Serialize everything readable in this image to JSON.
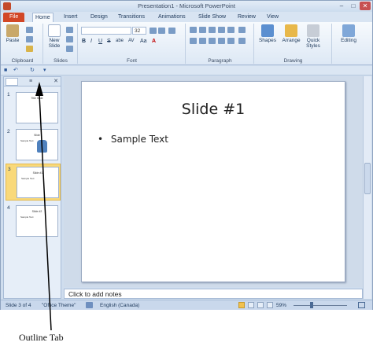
{
  "window": {
    "title": "Presentation1 - Microsoft PowerPoint",
    "min_icon": "–",
    "max_icon": "□",
    "close_icon": "✕"
  },
  "tabs": [
    "File",
    "Home",
    "Insert",
    "Design",
    "Transitions",
    "Animations",
    "Slide Show",
    "Review",
    "View"
  ],
  "ribbon": {
    "clipboard": {
      "paste_label": "Paste",
      "group_label": "Clipboard"
    },
    "slides": {
      "new_slide_label": "New Slide",
      "group_label": "Slides"
    },
    "font": {
      "font_size": "32",
      "bold": "B",
      "italic": "I",
      "underline": "U",
      "strike": "S",
      "shadow": "abe",
      "spacing": "AV",
      "case": "Aa",
      "color": "A",
      "group_label": "Font"
    },
    "paragraph": {
      "group_label": "Paragraph"
    },
    "drawing": {
      "shapes_label": "Shapes",
      "arrange_label": "Arrange",
      "quick_styles_label": "Quick Styles",
      "group_label": "Drawing"
    },
    "editing": {
      "editing_label": "Editing"
    }
  },
  "qat": {
    "save": "■",
    "undo": "↶",
    "redo": "↻",
    "more": "▾"
  },
  "pane": {
    "outline_tab_icon": "≡",
    "close_icon": "✕",
    "slides": [
      {
        "num": "1",
        "title": "Title Slide",
        "body": ""
      },
      {
        "num": "2",
        "title": "Slide",
        "body": "Sample Text"
      },
      {
        "num": "3",
        "title": "Slide #1",
        "body": "Sample Text"
      },
      {
        "num": "4",
        "title": "Slide #2",
        "body": "Sample Text"
      }
    ]
  },
  "slide": {
    "title": "Slide #1",
    "bullet": "•",
    "body": "Sample Text"
  },
  "notes": {
    "placeholder": "Click to add notes"
  },
  "status": {
    "slide_count": "Slide 3 of 4",
    "theme": "\"Office Theme\"",
    "language": "English (Canada)",
    "zoom": "59%"
  },
  "annotation": {
    "caption": "Outline Tab"
  },
  "colors": {
    "file_tab": "#d24726",
    "selected_thumb": "#f9d97a"
  }
}
